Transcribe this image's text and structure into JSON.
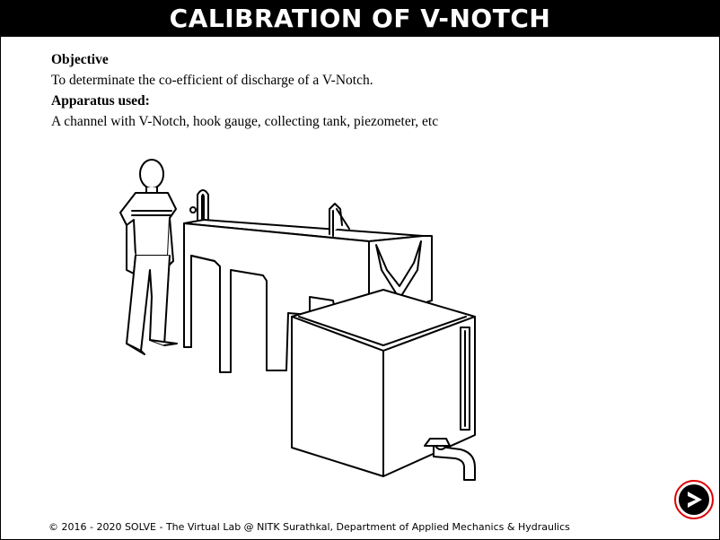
{
  "header": {
    "title": "CALIBRATION OF V-NOTCH"
  },
  "intro": {
    "objective_heading": "Objective",
    "objective_text": "To determinate the co-efficient of discharge of a V-Notch.",
    "apparatus_heading": "Apparatus used:",
    "apparatus_text": "A channel with V-Notch, hook gauge, collecting tank, piezometer, etc"
  },
  "footer": {
    "copyright": "© 2016 - 2020 SOLVE - The Virtual Lab @ NITK Surathkal, Department of Applied Mechanics & Hydraulics"
  },
  "navigation": {
    "next_icon": "next-arrow-icon",
    "accent_color": "#dd0000"
  }
}
